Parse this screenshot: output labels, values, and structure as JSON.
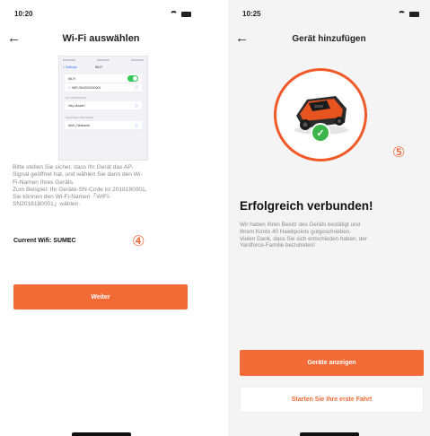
{
  "left_screen": {
    "status_time": "10:20",
    "title": "Wi-Fi auswählen",
    "mini": {
      "back": "< Settings",
      "title": "Wi-Fi",
      "wifi_label": "Wi-Fi",
      "connected_network": "WiFi-SN2020000001",
      "networks_header": "MY NETWORKS",
      "network_2": "Hey Mower!",
      "other_header": "CHOOSE A NETWORK",
      "network_3": "Arbh_Netzwerk"
    },
    "instruction_lines": [
      "Bitte stellen Sie sicher, dass Ihr Gerät das AP-",
      "Signal geöffnet hat, und wählen Sie dann den Wi-",
      "Fi-Namen Ihres Geräts.",
      "Zum Beispiel: Ihr Geräte-SN-Code ist 2018180001,",
      "Sie können den Wi-Fi-Namen「WIFI-",
      "SN2018180001」wählen."
    ],
    "current_wifi_label": "Current Wifi:",
    "current_wifi_value": "SUMEC",
    "step_number": "④",
    "button_label": "Weiter"
  },
  "right_screen": {
    "status_time": "10:25",
    "title": "Gerät hinzufügen",
    "step_number": "⑤",
    "success_title": "Erfolgreich verbunden!",
    "success_lines": [
      "Wir haben Ihren Besitz des Geräts bestätigt und",
      "Ihrem Konto 40 Hawkpoints gutgeschrieben.",
      "Vielen Dank, dass Sie sich entschieden haben, der",
      "Yardforce-Familie beizutreten!"
    ],
    "primary_button": "Geräte anzeigen",
    "secondary_button": "Starten Sie Ihre erste Fahrt"
  },
  "icons": {
    "back": "arrow-left-icon",
    "wifi": "wifi-icon",
    "battery": "battery-icon",
    "check": "checkmark-icon"
  },
  "colors": {
    "accent": "#f26a35",
    "success": "#3cb54a",
    "ios_blue": "#3478f6"
  }
}
